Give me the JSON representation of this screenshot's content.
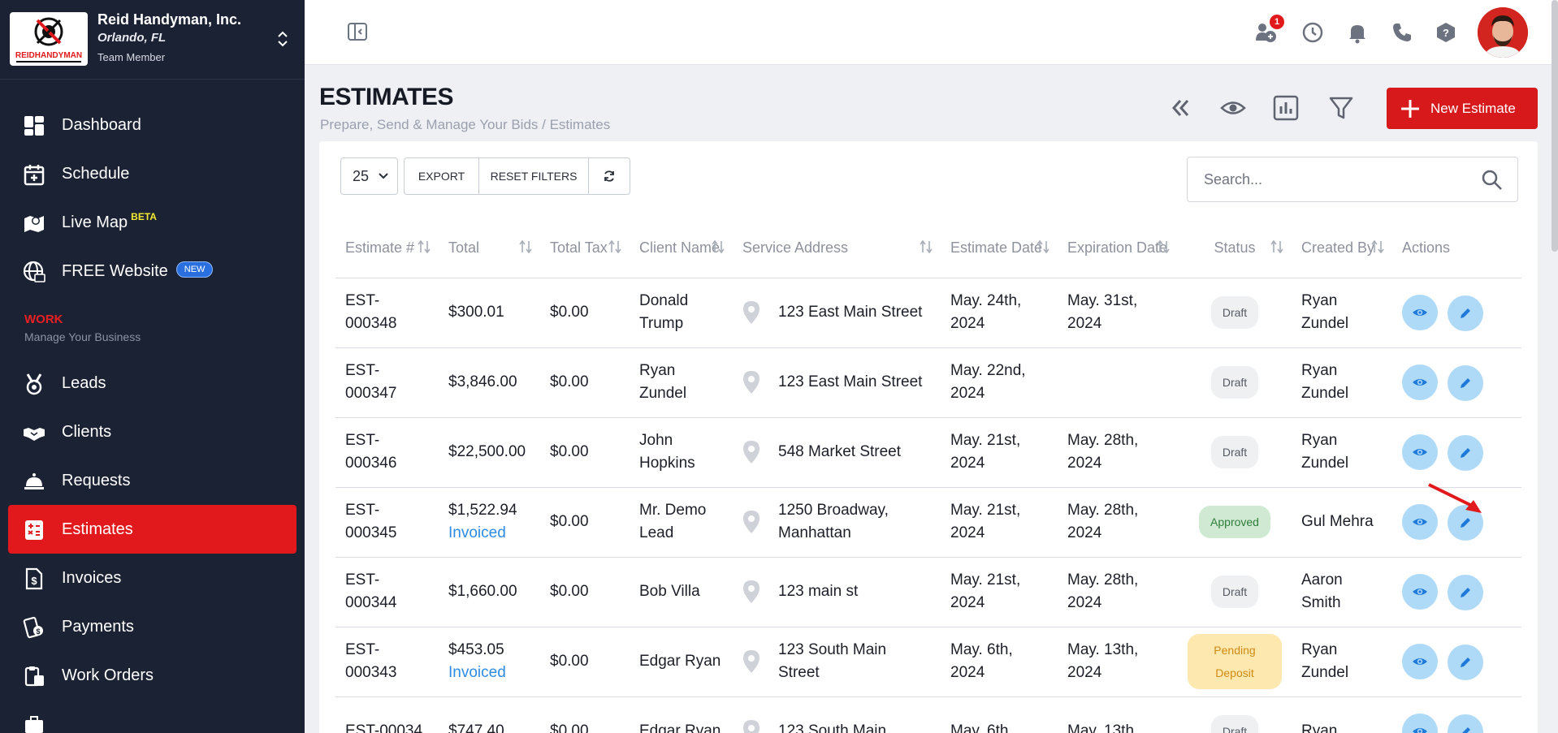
{
  "company": {
    "name": "Reid Handyman, Inc.",
    "city": "Orlando, FL",
    "role": "Team Member",
    "logo_text": "REIDHANDYMAN"
  },
  "nav": {
    "dashboard": "Dashboard",
    "schedule": "Schedule",
    "live_map": "Live Map",
    "live_map_badge": "BETA",
    "free_website": "FREE Website",
    "free_website_badge": "NEW",
    "section_title": "WORK",
    "section_sub": "Manage Your Business",
    "leads": "Leads",
    "clients": "Clients",
    "requests": "Requests",
    "estimates": "Estimates",
    "invoices": "Invoices",
    "payments": "Payments",
    "work_orders": "Work Orders"
  },
  "topbar": {
    "notification_count": "1"
  },
  "page": {
    "title": "ESTIMATES",
    "subtitle": "Prepare, Send & Manage Your Bids / Estimates",
    "new_button": "New Estimate"
  },
  "controls": {
    "per_page": "25",
    "export": "EXPORT",
    "reset": "RESET FILTERS",
    "search_placeholder": "Search..."
  },
  "table": {
    "headers": {
      "estimate": "Estimate #",
      "total": "Total",
      "total_tax": "Total Tax",
      "client": "Client Name",
      "address": "Service Address",
      "estimate_date": "Estimate Date",
      "expiration_date": "Expiration Date",
      "status": "Status",
      "created_by": "Created By",
      "actions": "Actions"
    },
    "rows": [
      {
        "id": "EST-000348",
        "total": "$300.01",
        "invoiced": "",
        "tax": "$0.00",
        "client": "Donald Trump",
        "address": "123 East Main Street",
        "est_date": "May. 24th, 2024",
        "exp_date": "May. 31st, 2024",
        "status": "Draft",
        "created_by": "Ryan Zundel"
      },
      {
        "id": "EST-000347",
        "total": "$3,846.00",
        "invoiced": "",
        "tax": "$0.00",
        "client": "Ryan Zundel",
        "address": "123 East Main Street",
        "est_date": "May. 22nd, 2024",
        "exp_date": "",
        "status": "Draft",
        "created_by": "Ryan Zundel"
      },
      {
        "id": "EST-000346",
        "total": "$22,500.00",
        "invoiced": "",
        "tax": "$0.00",
        "client": "John Hopkins",
        "address": "548 Market Street",
        "est_date": "May. 21st, 2024",
        "exp_date": "May. 28th, 2024",
        "status": "Draft",
        "created_by": "Ryan Zundel"
      },
      {
        "id": "EST-000345",
        "total": "$1,522.94",
        "invoiced": "Invoiced",
        "tax": "$0.00",
        "client": "Mr. Demo Lead",
        "address": "1250 Broadway, Manhattan",
        "est_date": "May. 21st, 2024",
        "exp_date": "May. 28th, 2024",
        "status": "Approved",
        "created_by": "Gul Mehra"
      },
      {
        "id": "EST-000344",
        "total": "$1,660.00",
        "invoiced": "",
        "tax": "$0.00",
        "client": "Bob Villa",
        "address": "123 main st",
        "est_date": "May. 21st, 2024",
        "exp_date": "May. 28th, 2024",
        "status": "Draft",
        "created_by": "Aaron Smith"
      },
      {
        "id": "EST-000343",
        "total": "$453.05",
        "invoiced": "Invoiced",
        "tax": "$0.00",
        "client": "Edgar Ryan",
        "address": "123 South Main Street",
        "est_date": "May. 6th, 2024",
        "exp_date": "May. 13th, 2024",
        "status": "Pending Deposit",
        "created_by": "Ryan Zundel"
      },
      {
        "id": "EST-00034",
        "total": "$747.40",
        "invoiced": "",
        "tax": "$0.00",
        "client": "Edgar Ryan",
        "address": "123 South Main",
        "est_date": "May. 6th,",
        "exp_date": "May. 13th,",
        "status": "Draft",
        "created_by": "Ryan"
      }
    ]
  },
  "colors": {
    "sidebar_bg": "#1b2233",
    "accent_red": "#e2191c",
    "action_blue": "#aedaf7",
    "link_blue": "#2d8be4"
  }
}
